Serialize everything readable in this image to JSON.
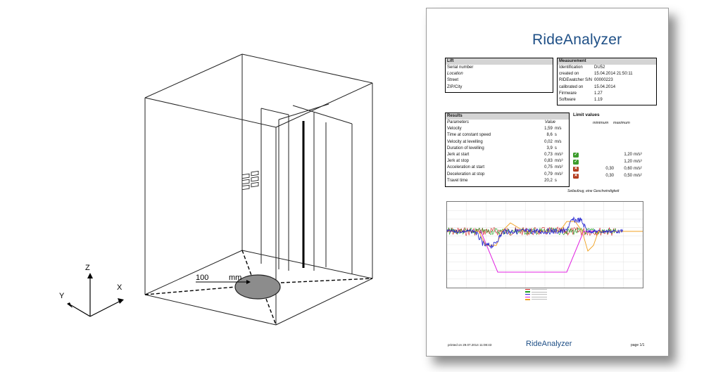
{
  "drawing": {
    "dimension_value": "100",
    "dimension_unit": "mm",
    "axis_z": "Z",
    "axis_x": "X",
    "axis_y": "Y"
  },
  "report": {
    "brand": "RideAnalyzer",
    "lift": {
      "title": "Lift",
      "rows": [
        "Serial number",
        "Location",
        "Street",
        "ZIP/City"
      ]
    },
    "measurement": {
      "title": "Measurement",
      "rows": [
        {
          "label": "Identification",
          "value": "DU52"
        },
        {
          "label": "created on",
          "value": "15.04.2014 21:50:11"
        },
        {
          "label": "RIDEwatcher S/N",
          "value": "00000223"
        },
        {
          "label": "calibrated on",
          "value": "15.04.2014"
        },
        {
          "label": "Firmware",
          "value": "1.27"
        },
        {
          "label": "Software",
          "value": "1.19"
        }
      ]
    },
    "results": {
      "title": "Results",
      "param_header": "Parameters",
      "value_header": "Value",
      "rows": [
        {
          "label": "Velocity",
          "value": "1,59",
          "unit": "m/s"
        },
        {
          "label": "Time at constant speed",
          "value": "8,6",
          "unit": "s"
        },
        {
          "label": "Velocity at levelling",
          "value": "0,02",
          "unit": "m/s"
        },
        {
          "label": "Duration of levelling",
          "value": "3,9",
          "unit": "s"
        },
        {
          "label": "Jerk at start",
          "value": "0,73",
          "unit": "m/s³"
        },
        {
          "label": "Jerk at stop",
          "value": "0,83",
          "unit": "m/s³"
        },
        {
          "label": "Acceleration at start",
          "value": "0,75",
          "unit": "m/s²"
        },
        {
          "label": "Deceleration at stop",
          "value": "0,79",
          "unit": "m/s²"
        },
        {
          "label": "Travel time",
          "value": "20,2",
          "unit": "s"
        }
      ]
    },
    "limits": {
      "title": "Limit values",
      "min_header": "minimum",
      "max_header": "maximum",
      "rows": [
        {
          "status": "ok",
          "min": "",
          "max": "1,20",
          "unit": "m/s³"
        },
        {
          "status": "ok",
          "min": "",
          "max": "1,20",
          "unit": "m/s³"
        },
        {
          "status": "fail",
          "min": "0,30",
          "max": "0,60",
          "unit": "m/s²"
        },
        {
          "status": "fail",
          "min": "0,30",
          "max": "0,50",
          "unit": "m/s²"
        }
      ]
    },
    "caption": "Seilaufzug, eine Geschwindigkeit",
    "footer": {
      "printed": "printed on 29.07.2014 11:08:43",
      "page": "page 1/1"
    },
    "colors": {
      "brand": "#1e4f86",
      "ok": "#3c9c2c",
      "fail": "#b43c1e",
      "velocity": "#e020e0",
      "acceleration": "#2020d0",
      "jerk": "#f0a020",
      "noise_red": "#d02020",
      "noise_green": "#20a020"
    }
  }
}
